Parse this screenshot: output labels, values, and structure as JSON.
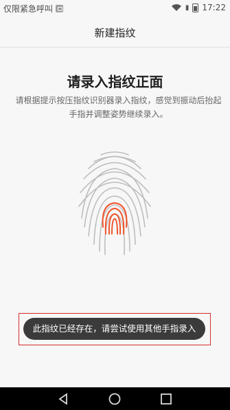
{
  "status": {
    "carrier_text": "仅限紧急呼叫",
    "time": "17:22"
  },
  "header": {
    "title": "新建指纹"
  },
  "main": {
    "heading": "请录入指纹正面",
    "instruction": "请根据提示按压指纹识别器录入指纹，感觉到振动后抬起手指并调整姿势继续录入。"
  },
  "toast": {
    "message": "此指纹已经存在，请尝试使用其他手指录入"
  },
  "colors": {
    "fingerprint_progress": "#f0522a",
    "fingerprint_base": "#bdbdbd",
    "highlight_border": "#d62b2b"
  },
  "icons": {
    "status": [
      "message-icon",
      "wifi-icon",
      "sim-icon",
      "battery-icon"
    ],
    "navigation": [
      "back-icon",
      "home-icon",
      "recents-icon"
    ]
  }
}
